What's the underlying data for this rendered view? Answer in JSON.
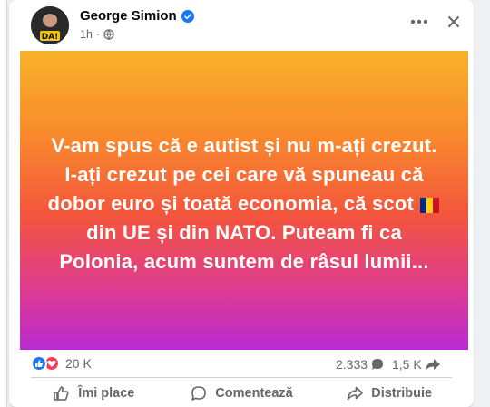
{
  "post": {
    "author": "George Simion",
    "timestamp": "1h",
    "avatar_badge": "DA!",
    "banner_lines": {
      "part1": "V-am spus că e autist și nu m-ați crezut. I-ați crezut pe cei care vă spuneau că dobor euro și toată economia, că scot",
      "part2": "din UE și din NATO. Puteam fi ca Polonia, acum suntem de râsul lumii..."
    },
    "flag_colors": [
      "#002b7f",
      "#fcd116",
      "#ce1126"
    ],
    "gradient_colors": [
      "#f8b22a",
      "#f98a2c",
      "#f3553d",
      "#dd3b90",
      "#b82bd2"
    ]
  },
  "stats": {
    "reactions_count": "20 K",
    "comments_count": "2.333",
    "shares_count": "1,5 K"
  },
  "actions": {
    "like": "Îmi place",
    "comment": "Comentează",
    "share": "Distribuie"
  },
  "icons": {
    "verified": "verified-badge-icon",
    "globe": "globe-icon",
    "more": "more-dots-icon",
    "close": "close-icon",
    "like_reaction": "like-reaction-icon",
    "love_reaction": "love-reaction-icon",
    "comment": "comment-bubble-icon",
    "share": "share-arrow-icon",
    "like": "thumbs-up-icon"
  },
  "colors": {
    "text_primary": "#050505",
    "text_secondary": "#65676b",
    "like_blue": "#1877f2",
    "love_red": "#f33e58"
  }
}
